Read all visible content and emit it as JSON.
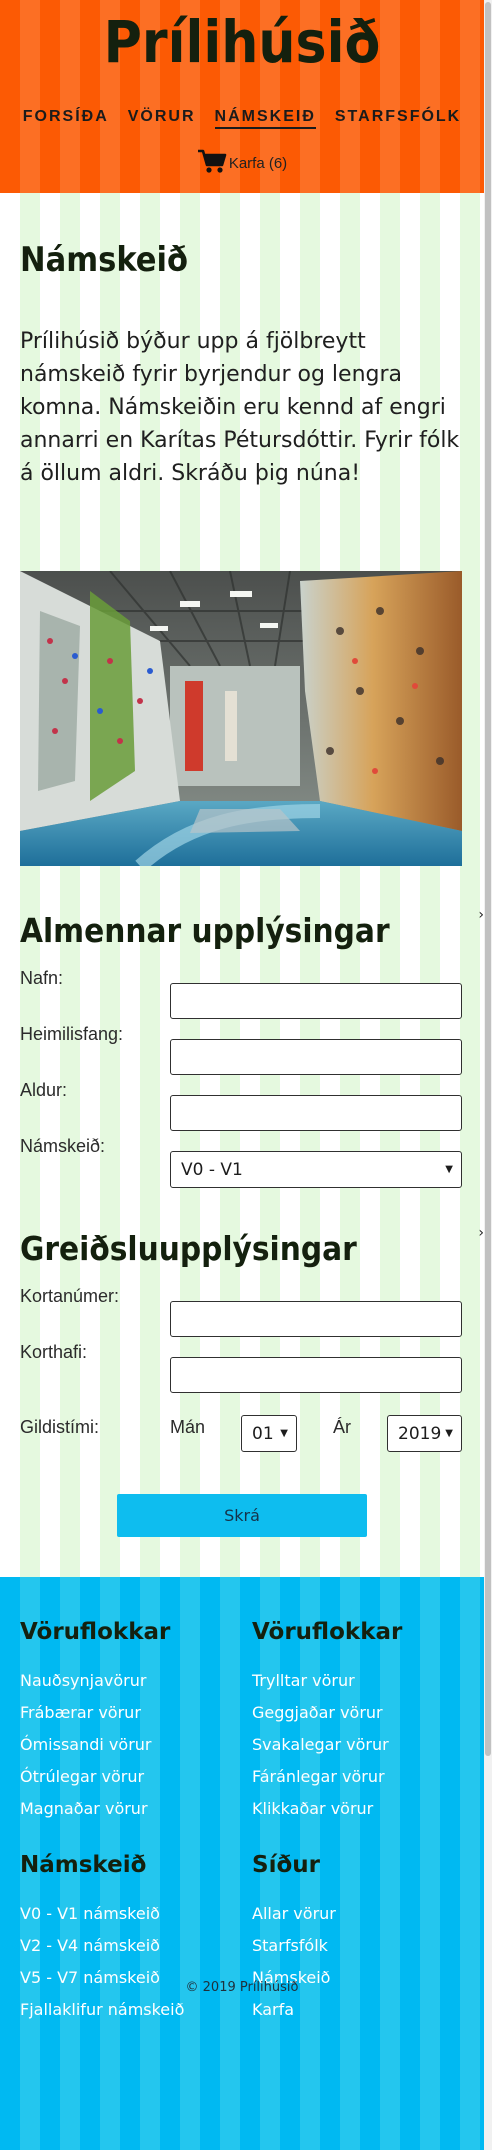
{
  "header": {
    "brand": "Prílihúsið",
    "nav": [
      "FORSÍÐA",
      "VÖRUR",
      "NÁMSKEIÐ",
      "STARFSFÓLK"
    ],
    "cart_label": "Karfa (6)"
  },
  "main": {
    "title": "Námskeið",
    "intro": "Prílihúsið býður upp á fjölbreytt námskeið fyrir byrjendur og lengra komna. Námskeiðin eru kennd af engri annarri en Karítas Pétursdóttir. Fyrir fólk á öllum aldri. Skráðu þig núna!",
    "general": {
      "heading": "Almennar upplýsingar",
      "name_label": "Nafn:",
      "address_label": "Heimilisfang:",
      "age_label": "Aldur:",
      "course_label": "Námskeið:",
      "course_value": "V0 - V1"
    },
    "payment": {
      "heading": "Greiðsluupplýsingar",
      "card_label": "Kortanúmer:",
      "holder_label": "Korthafi:",
      "expiry_label": "Gildistími:",
      "month_label": "Mán",
      "month_value": "01",
      "year_label": "Ár",
      "year_value": "2019"
    },
    "submit_label": "Skrá"
  },
  "footer": {
    "columns": [
      {
        "heading": "Vöruflokkar",
        "links": [
          "Nauðsynjavörur",
          "Frábærar vörur",
          "Ómissandi vörur",
          "Ótrúlegar vörur",
          "Magnaðar vörur"
        ]
      },
      {
        "heading": "Vöruflokkar",
        "links": [
          "Tryllтar vörur",
          "Geggjaðar vörur",
          "Svakalegar vörur",
          "Fáránlegar vörur",
          "Klikkaðar vörur"
        ]
      },
      {
        "heading": "Námskeið",
        "links": [
          "V0 - V1 námskeið",
          "V2 - V4 námskeið",
          "V5 - V7 námskeið",
          "Fjallaklifur námskeið"
        ]
      },
      {
        "heading": "Síður",
        "links": [
          "Allar vörur",
          "Starfsfólk",
          "Námskeið",
          "Karfa"
        ]
      }
    ],
    "copyright": "© 2019 Prílihúsið"
  },
  "colors": {
    "header_bg": "#fc5a04",
    "main_stripe": "#e5f9df",
    "footer_bg": "#00b9f2",
    "button_bg": "#0ebdef",
    "heading": "#14200e"
  },
  "icons": [
    "cart-icon",
    "select-arrow-icon",
    "photo-climbing-gym"
  ]
}
